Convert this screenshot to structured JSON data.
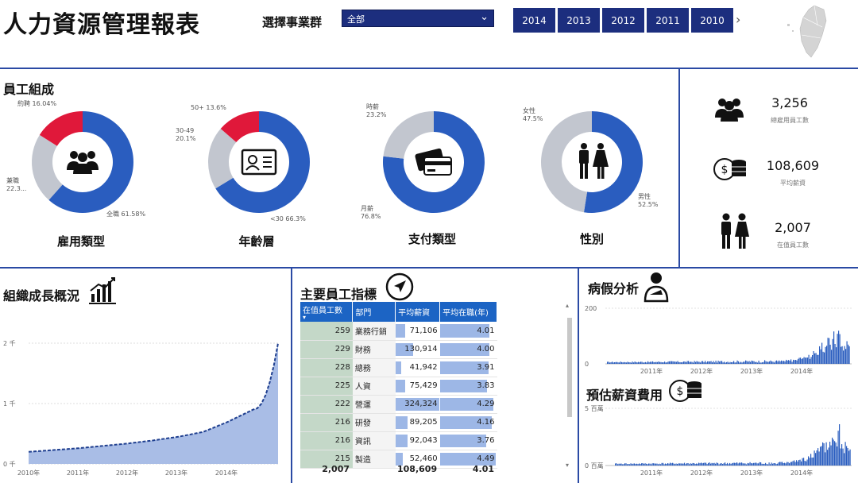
{
  "header": {
    "title": "人力資源管理報表",
    "filter_label": "選擇事業群",
    "filter_value": "全部",
    "years": [
      "2014",
      "2013",
      "2012",
      "2011",
      "2010"
    ]
  },
  "composition": {
    "title": "員工組成",
    "donuts": [
      {
        "caption": "雇用類型",
        "icon": "people-group-icon",
        "slices": [
          {
            "label": "全職 61.58%",
            "value": 61.58,
            "color": "#2a5dbf"
          },
          {
            "label": "兼職 22.3...",
            "value": 22.38,
            "color": "#c2c6cf"
          },
          {
            "label": "約聘 16.04%",
            "value": 16.04,
            "color": "#e0183a"
          }
        ]
      },
      {
        "caption": "年齡層",
        "icon": "id-card-icon",
        "slices": [
          {
            "label": "<30 66.3%",
            "value": 66.3,
            "color": "#2a5dbf"
          },
          {
            "label": "30-49 20.1%",
            "value": 20.1,
            "color": "#c2c6cf"
          },
          {
            "label": "50+ 13.6%",
            "value": 13.6,
            "color": "#e0183a"
          }
        ]
      },
      {
        "caption": "支付類型",
        "icon": "credit-card-icon",
        "slices": [
          {
            "label": "月薪 76.8%",
            "value": 76.8,
            "color": "#2a5dbf"
          },
          {
            "label": "時薪 23.2%",
            "value": 23.2,
            "color": "#c2c6cf"
          }
        ]
      },
      {
        "caption": "性別",
        "icon": "man-woman-icon",
        "slices": [
          {
            "label": "男性 52.5%",
            "value": 52.5,
            "color": "#2a5dbf"
          },
          {
            "label": "女性 47.5%",
            "value": 47.5,
            "color": "#c2c6cf"
          }
        ]
      }
    ]
  },
  "kpis": [
    {
      "value": "3,256",
      "label": "總雇用員工數",
      "icon": "people-group-icon"
    },
    {
      "value": "108,609",
      "label": "平均薪資",
      "icon": "coins-icon"
    },
    {
      "value": "2,007",
      "label": "在值員工數",
      "icon": "man-woman-icon"
    }
  ],
  "growth": {
    "title": "組織成長概況",
    "y_ticks": [
      "2 千",
      "1 千",
      "0 千"
    ],
    "x_ticks": [
      "2010年",
      "2011年",
      "2012年",
      "2013年",
      "2014年"
    ]
  },
  "indicators": {
    "title": "主要員工指標",
    "columns": [
      "在值員工數",
      "部門",
      "平均薪資",
      "平均在職(年)"
    ],
    "rows": [
      {
        "count": "259",
        "dept": "業務行銷",
        "salary": "71,106",
        "tenure": "4.01"
      },
      {
        "count": "229",
        "dept": "財務",
        "salary": "130,914",
        "tenure": "4.00"
      },
      {
        "count": "228",
        "dept": "總務",
        "salary": "41,942",
        "tenure": "3.91"
      },
      {
        "count": "225",
        "dept": "人資",
        "salary": "75,429",
        "tenure": "3.83"
      },
      {
        "count": "222",
        "dept": "營運",
        "salary": "324,324",
        "tenure": "4.29"
      },
      {
        "count": "216",
        "dept": "研發",
        "salary": "89,205",
        "tenure": "4.16"
      },
      {
        "count": "216",
        "dept": "資訊",
        "salary": "92,043",
        "tenure": "3.76"
      },
      {
        "count": "215",
        "dept": "製造",
        "salary": "52,460",
        "tenure": "4.49"
      }
    ],
    "totals": {
      "count": "2,007",
      "salary": "108,609",
      "tenure": "4.01"
    }
  },
  "sick_leave": {
    "title": "病假分析",
    "y_ticks": [
      "200",
      "0"
    ],
    "x_ticks": [
      "2011年",
      "2012年",
      "2013年",
      "2014年"
    ]
  },
  "salary_cost": {
    "title": "預估薪資費用",
    "y_ticks": [
      "5 百萬",
      "0 百萬"
    ],
    "x_ticks": [
      "2011年",
      "2012年",
      "2013年",
      "2014年"
    ]
  },
  "chart_data": [
    {
      "type": "area",
      "title": "組織成長概況",
      "x": [
        "2010",
        "2010.5",
        "2011",
        "2011.5",
        "2012",
        "2012.5",
        "2013",
        "2013.5",
        "2014",
        "2014.5",
        "2015"
      ],
      "series": [
        {
          "values": [
            200,
            230,
            260,
            300,
            340,
            390,
            450,
            530,
            700,
            900,
            2000
          ]
        }
      ],
      "ylim": [
        0,
        2000
      ],
      "yunit": "千"
    },
    {
      "type": "bar",
      "title": "病假分析",
      "x": [
        "2011",
        "2012",
        "2013",
        "2014"
      ],
      "series": [
        {
          "values": [
            5,
            6,
            8,
            200
          ]
        }
      ],
      "ylim": [
        0,
        200
      ]
    },
    {
      "type": "bar",
      "title": "預估薪資費用",
      "x": [
        "2011",
        "2012",
        "2013",
        "2014"
      ],
      "series": [
        {
          "values": [
            0.2,
            0.3,
            0.4,
            5
          ]
        }
      ],
      "ylim": [
        0,
        5
      ],
      "yunit": "百萬"
    }
  ]
}
